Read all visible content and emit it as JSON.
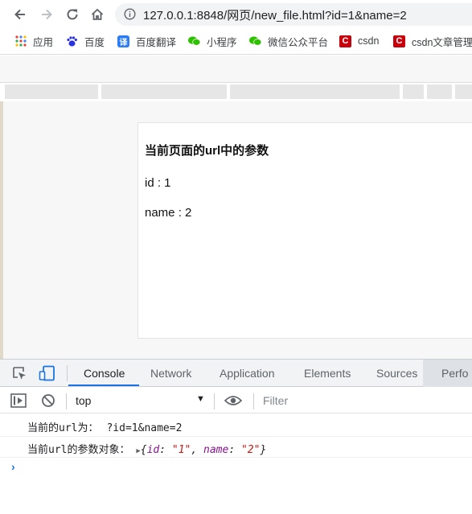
{
  "browser": {
    "url": "127.0.0.1:8848/网页/new_file.html?id=1&name=2",
    "icons": {
      "back": "back-arrow-icon",
      "forward": "forward-arrow-icon",
      "reload": "reload-icon",
      "home": "home-icon",
      "info": "info-icon"
    }
  },
  "bookmarks": [
    {
      "label": "应用",
      "icon": "apps-grid-icon"
    },
    {
      "label": "百度",
      "icon": "baidu-paw-icon"
    },
    {
      "label": "百度翻译",
      "icon": "translate-icon"
    },
    {
      "label": "小程序",
      "icon": "wechat-icon"
    },
    {
      "label": "微信公众平台",
      "icon": "wechat-icon"
    },
    {
      "label": "csdn",
      "icon": "csdn-icon"
    },
    {
      "label": "csdn文章管理",
      "icon": "csdn-icon"
    }
  ],
  "page": {
    "title": "当前页面的url中的参数",
    "id_line": "id : 1",
    "name_line": "name : 2"
  },
  "devtools": {
    "tabs": [
      "Console",
      "Network",
      "Application",
      "Elements",
      "Sources",
      "Perfo"
    ],
    "active_tab": "Console",
    "context": "top",
    "filter_placeholder": "Filter",
    "logs": {
      "line1_label": "当前的url为：",
      "line1_value": "?id=1&name=2",
      "line2_label": "当前url的参数对象：",
      "obj_open": "{",
      "obj_id_key": "id",
      "obj_id_val": "\"1\"",
      "obj_name_key": "name",
      "obj_name_val": "\"2\"",
      "obj_close": "}"
    },
    "prompt": "›",
    "colors": {
      "accent": "#1a73e8",
      "string": "#c41a16",
      "key": "#881391"
    }
  }
}
